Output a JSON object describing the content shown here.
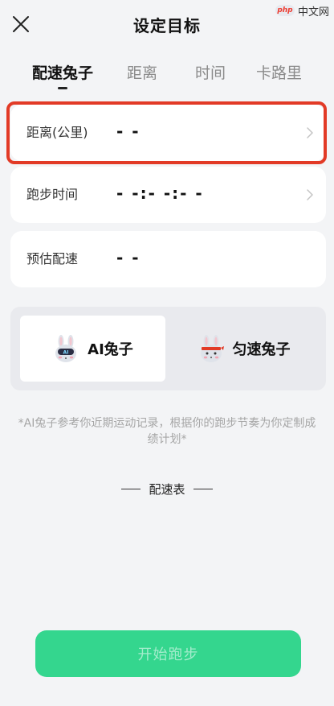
{
  "header": {
    "title": "设定目标",
    "close_icon": "close-icon"
  },
  "watermark": {
    "logo_text": "php",
    "site_text": "中文网"
  },
  "tabs": [
    {
      "label": "配速兔子",
      "active": true
    },
    {
      "label": "距离",
      "active": false
    },
    {
      "label": "时间",
      "active": false
    },
    {
      "label": "卡路里",
      "active": false
    }
  ],
  "fields": {
    "distance": {
      "label": "距离(公里)",
      "value": "- -",
      "icon": "chevron-right-icon"
    },
    "time": {
      "label": "跑步时间",
      "value": "- -:- -:- -",
      "icon": "chevron-right-icon"
    },
    "pace": {
      "label": "预估配速",
      "value": "- -"
    }
  },
  "modes": {
    "ai": {
      "label": "AI兔子",
      "badge": "AI",
      "icon": "ai-rabbit-icon",
      "selected": true
    },
    "steady": {
      "label": "匀速兔子",
      "icon": "steady-rabbit-icon",
      "selected": false
    }
  },
  "note": "*AI兔子参考你近期运动记录，根据你的跑步节奏为你定制成绩计划*",
  "pace_table_title": "配速表",
  "start_button": "开始跑步",
  "colors": {
    "highlight": "#e23a26",
    "accent_green": "#34d68e",
    "background": "#f3f4f6"
  }
}
